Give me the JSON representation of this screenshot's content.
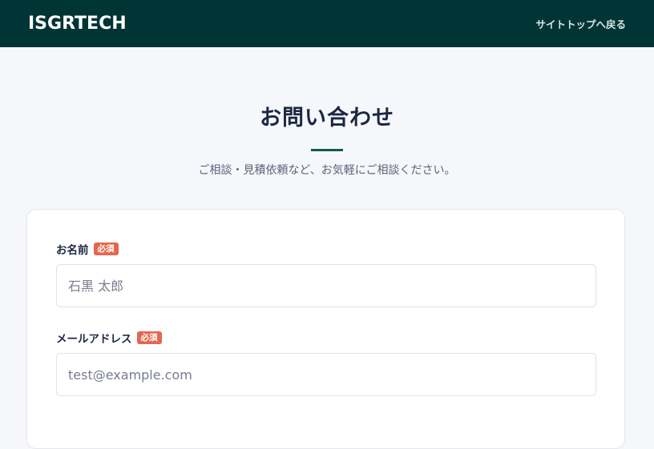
{
  "header": {
    "logo_text": "ISGRTECH",
    "back_link_label": "サイトトップへ戻る"
  },
  "hero": {
    "title": "お問い合わせ",
    "subtitle": "ご相談・見積依頼など、お気軽にご相談ください。"
  },
  "form": {
    "fields": [
      {
        "label": "お名前",
        "badge": "必須",
        "placeholder": "石黒 太郎"
      },
      {
        "label": "メールアドレス",
        "badge": "必須",
        "placeholder": "test@example.com"
      }
    ]
  },
  "colors": {
    "header_bg": "#003435",
    "accent": "#0f5c56",
    "required_badge": "#e2674f",
    "page_bg": "#f6f7fb"
  }
}
